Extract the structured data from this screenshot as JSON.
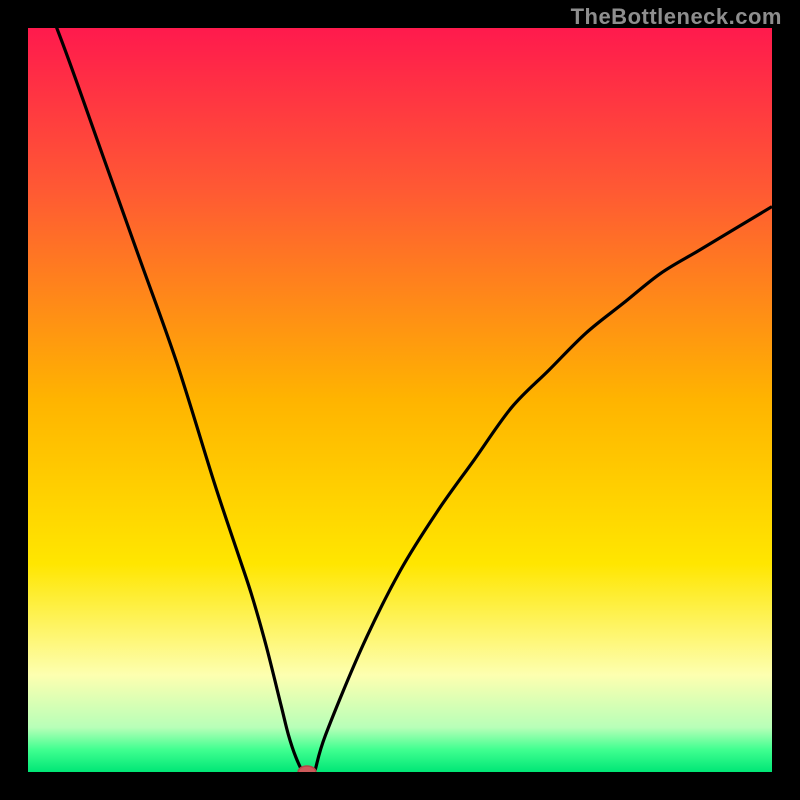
{
  "watermark": "TheBottleneck.com",
  "colors": {
    "gradient_top": "#ff1a4d",
    "gradient_upper": "#ff5a33",
    "gradient_mid": "#ffb400",
    "gradient_lower": "#ffe600",
    "gradient_pale": "#fdffb0",
    "gradient_green_light": "#80ff80",
    "gradient_green": "#00e676",
    "curve": "#000000",
    "marker_fill": "#cc5a5a",
    "marker_border": "#b34747",
    "frame": "#000000"
  },
  "chart_data": {
    "type": "line",
    "title": "",
    "xlabel": "",
    "ylabel": "",
    "xlim": [
      0,
      100
    ],
    "ylim": [
      0,
      100
    ],
    "grid": false,
    "series": [
      {
        "name": "bottleneck-curve",
        "x": [
          0,
          5,
          10,
          15,
          20,
          25,
          28,
          30,
          32,
          34,
          35,
          36,
          37,
          38,
          38.5,
          40,
          45,
          50,
          55,
          60,
          65,
          70,
          75,
          80,
          85,
          90,
          95,
          100
        ],
        "y": [
          110,
          97,
          83,
          69,
          55,
          39,
          30,
          24,
          17,
          9,
          5,
          2,
          0,
          0,
          0,
          5,
          17,
          27,
          35,
          42,
          49,
          54,
          59,
          63,
          67,
          70,
          73,
          76
        ]
      }
    ],
    "marker": {
      "x": 37.5,
      "y": 0,
      "rx": 1.2,
      "ry": 0.8
    },
    "background_gradient_stops": [
      {
        "pct": 0,
        "color": "#ff1a4d"
      },
      {
        "pct": 22,
        "color": "#ff5a33"
      },
      {
        "pct": 50,
        "color": "#ffb400"
      },
      {
        "pct": 72,
        "color": "#ffe600"
      },
      {
        "pct": 87,
        "color": "#fdffb0"
      },
      {
        "pct": 94,
        "color": "#b8ffb8"
      },
      {
        "pct": 97,
        "color": "#40ff90"
      },
      {
        "pct": 100,
        "color": "#00e676"
      }
    ]
  }
}
